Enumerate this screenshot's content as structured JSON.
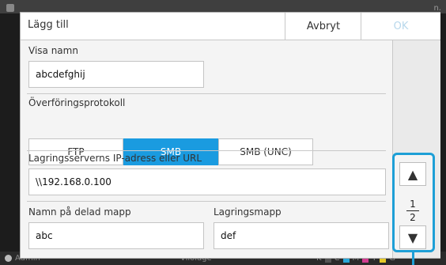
{
  "background": {
    "top_right_text": "n.",
    "user": "Admin",
    "mode": "Viloläge",
    "inks": [
      "K",
      "C",
      "M",
      "Y",
      "G"
    ]
  },
  "dialog": {
    "title": "Lägg till",
    "cancel_label": "Avbryt",
    "ok_label": "OK"
  },
  "fields": {
    "display_name_label": "Visa namn",
    "display_name_value": "abcdefghij",
    "protocol_label": "Överföringsprotokoll",
    "protocol_options": [
      "FTP",
      "SMB",
      "SMB (UNC)"
    ],
    "protocol_selected": "SMB",
    "server_label": "Lagringsserverns IP-adress eller URL",
    "server_value": "\\\\192.168.0.100",
    "shared_folder_label": "Namn på delad mapp",
    "shared_folder_value": "abc",
    "storage_folder_label": "Lagringsmapp",
    "storage_folder_value": "def"
  },
  "pagination": {
    "current": "1",
    "total": "2"
  },
  "colors": {
    "accent": "#1a9be0",
    "highlight": "#1e9fd6",
    "ok_disabled": "#b8d8ec"
  },
  "icons": {
    "up": "triangle-up-icon",
    "down": "triangle-down-icon"
  }
}
